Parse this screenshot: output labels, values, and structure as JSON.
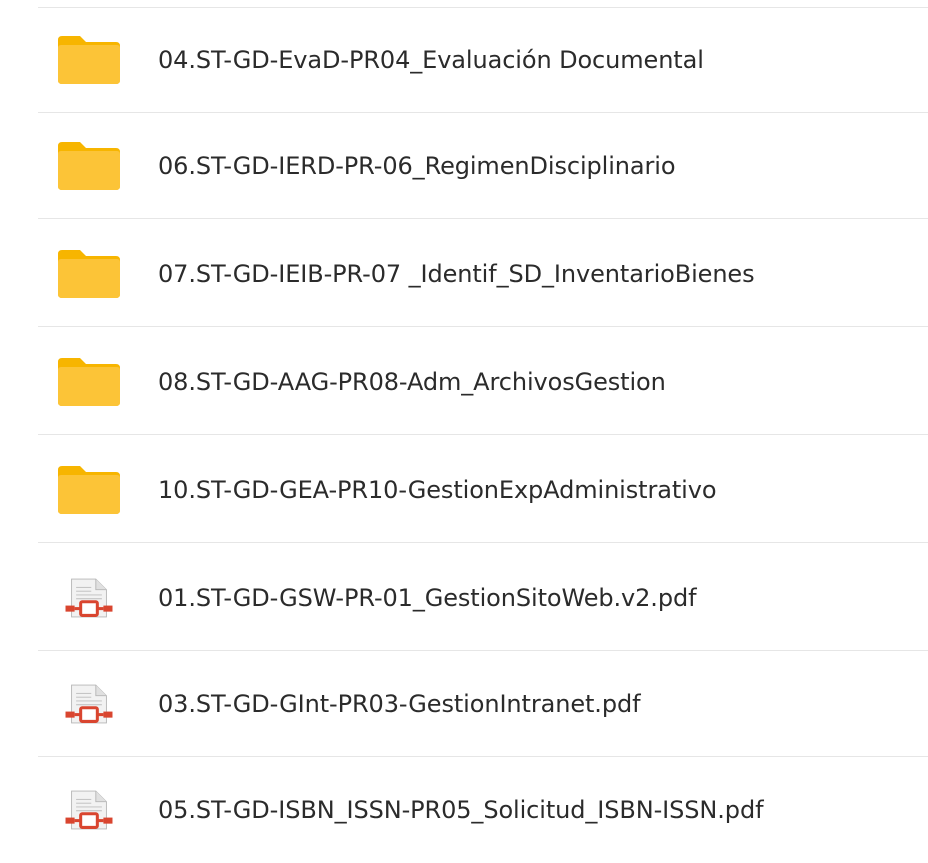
{
  "files": [
    {
      "name": "04.ST-GD-EvaD-PR04_Evaluación Documental",
      "icon": "folder-icon"
    },
    {
      "name": "06.ST-GD-IERD-PR-06_RegimenDisciplinario",
      "icon": "folder-icon"
    },
    {
      "name": "07.ST-GD-IEIB-PR-07 _Identif_SD_InventarioBienes",
      "icon": "folder-icon"
    },
    {
      "name": "08.ST-GD-AAG-PR08-Adm_ArchivosGestion",
      "icon": "folder-icon"
    },
    {
      "name": "10.ST-GD-GEA-PR10-GestionExpAdministrativo",
      "icon": "folder-icon"
    },
    {
      "name": "01.ST-GD-GSW-PR-01_GestionSitoWeb.v2.pdf",
      "icon": "pdf-file-icon"
    },
    {
      "name": "03.ST-GD-GInt-PR03-GestionIntranet.pdf",
      "icon": "pdf-file-icon"
    },
    {
      "name": "05.ST-GD-ISBN_ISSN-PR05_Solicitud_ISBN-ISSN.pdf",
      "icon": "pdf-file-icon"
    }
  ],
  "colors": {
    "folder_body": "#fcc437",
    "folder_tab": "#f7b500",
    "pdf_accent": "#d9452f",
    "pdf_page": "#f2f2f2",
    "text": "#2b2b2b",
    "separator": "#e6e6e6"
  }
}
